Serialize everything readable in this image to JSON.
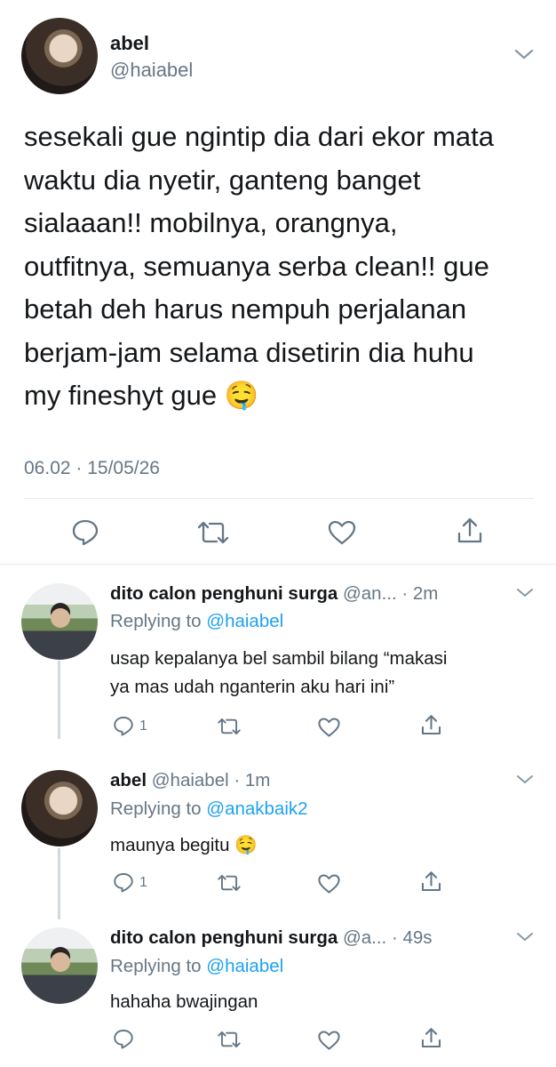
{
  "main_tweet": {
    "author_name": "abel",
    "author_handle": "@haiabel",
    "text_lines": [
      "sesekali gue ngintip dia dari ekor mata",
      "waktu dia nyetir, ganteng banget",
      "sialaaan!! mobilnya, orangnya,",
      "outfitnya, semuanya serba clean!! gue",
      "betah deh harus nempuh perjalanan",
      "berjam-jam selama disetirin dia huhu",
      "my fineshyt gue 🤤"
    ],
    "timestamp": "06.02 · 15/05/26",
    "actions": [
      "reply-icon",
      "retweet-icon",
      "like-icon",
      "share-icon"
    ]
  },
  "replies": [
    {
      "name": "dito calon penghuni surga",
      "handle_time": "@an... · 2m",
      "replying_prefix": "Replying to",
      "replying_to": "@haiabel",
      "text_lines": [
        "usap kepalanya bel sambil bilang “makasi",
        "ya mas udah nganterin aku hari ini”"
      ],
      "reply_count": "1"
    },
    {
      "name": "abel",
      "handle_time": "@haiabel · 1m",
      "replying_prefix": "Replying to",
      "replying_to": "@anakbaik2",
      "text_lines": [
        "maunya begitu 🤤"
      ],
      "reply_count": "1"
    },
    {
      "name": "dito calon penghuni surga",
      "handle_time": "@a... · 49s",
      "replying_prefix": "Replying to",
      "replying_to": "@haiabel",
      "text_lines": [
        "hahaha bwajingan"
      ],
      "reply_count": ""
    }
  ],
  "colors": {
    "link": "#1da1f2",
    "secondary": "#657786",
    "icon": "#657786"
  }
}
